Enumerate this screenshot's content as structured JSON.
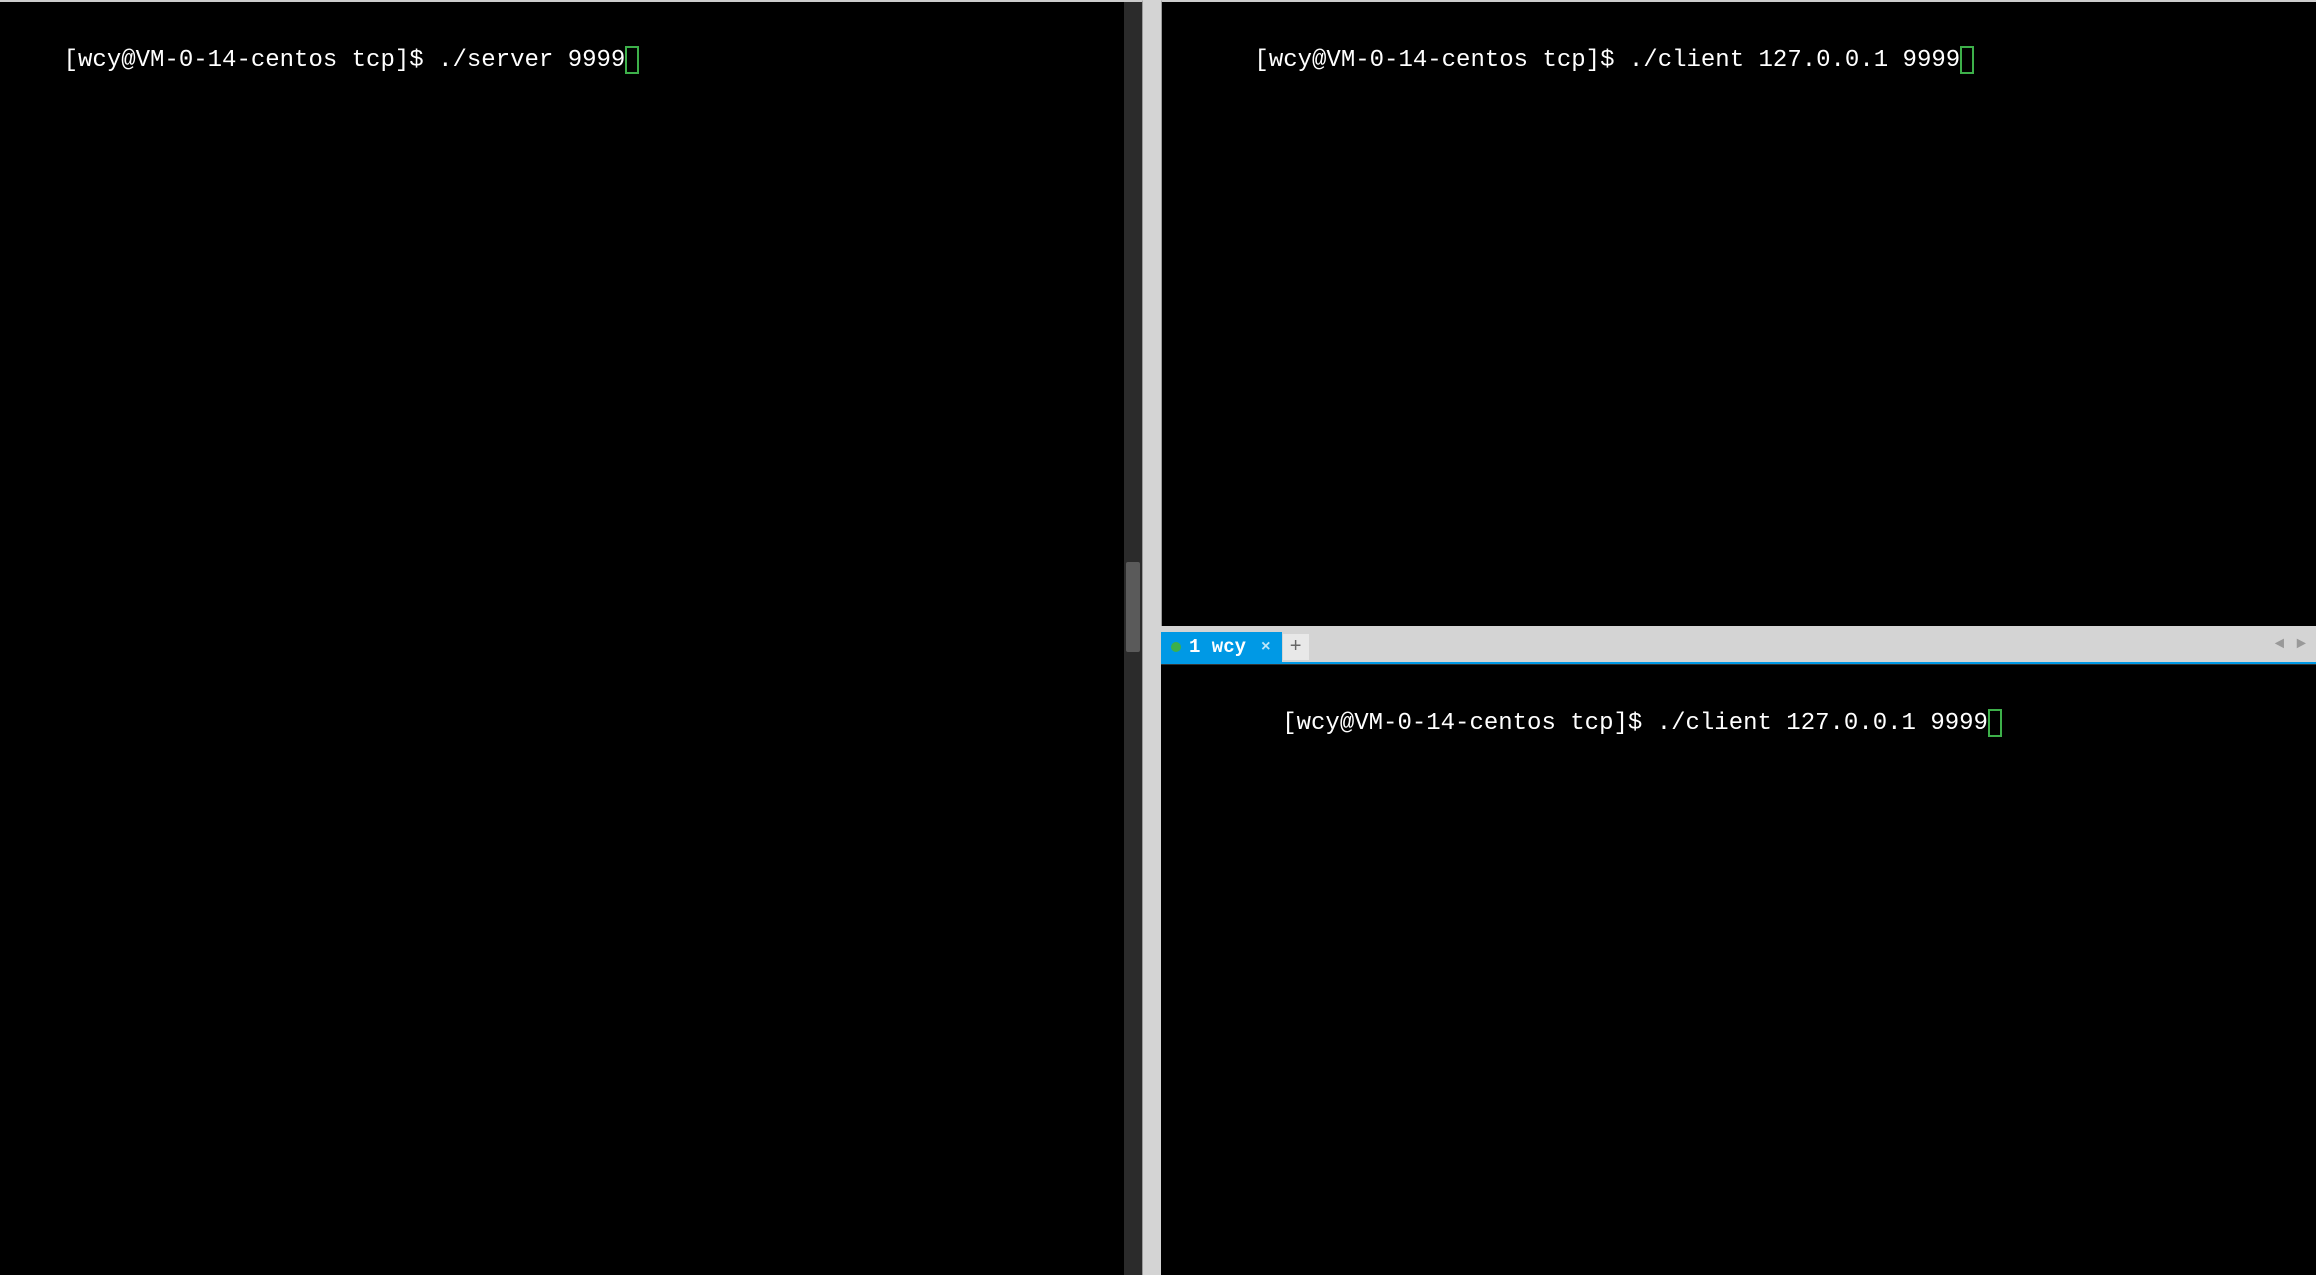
{
  "left": {
    "prompt": "[wcy@VM-0-14-centos tcp]$ ",
    "command": "./server 9999"
  },
  "rightTop": {
    "prompt": "[wcy@VM-0-14-centos tcp]$ ",
    "command": "./client 127.0.0.1 9999"
  },
  "rightBottom": {
    "tab": {
      "label": "1 wcy"
    },
    "prompt": "[wcy@VM-0-14-centos tcp]$ ",
    "command": "./client 127.0.0.1 9999"
  }
}
